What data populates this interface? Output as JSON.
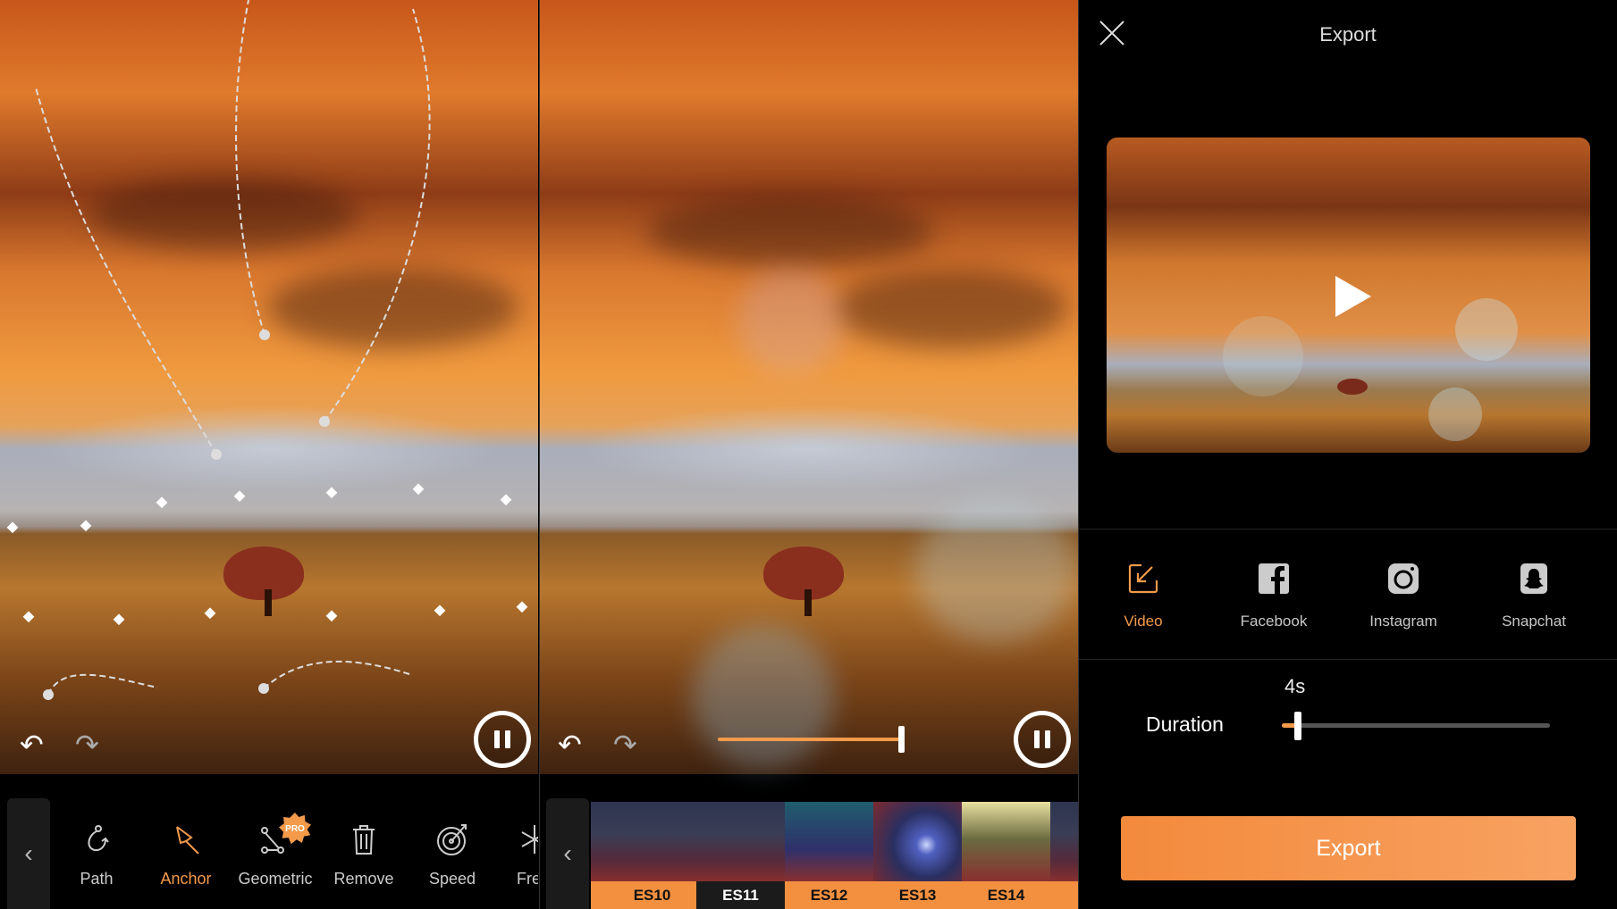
{
  "left_panel": {
    "tools": [
      {
        "label": "Path",
        "icon": "path-icon",
        "active": false
      },
      {
        "label": "Anchor",
        "icon": "anchor-pin-icon",
        "active": true
      },
      {
        "label": "Geometric",
        "icon": "geometric-icon",
        "active": false,
        "badge": "PRO"
      },
      {
        "label": "Remove",
        "icon": "trash-icon",
        "active": false
      },
      {
        "label": "Speed",
        "icon": "speed-icon",
        "active": false
      },
      {
        "label": "Fre",
        "icon": "freeze-icon",
        "active": false
      }
    ]
  },
  "middle_panel": {
    "intensity_fraction": 1.0,
    "effects": [
      {
        "label": "ES10",
        "selected": false
      },
      {
        "label": "ES11",
        "selected": true
      },
      {
        "label": "ES12",
        "selected": false
      },
      {
        "label": "ES13",
        "selected": false
      },
      {
        "label": "ES14",
        "selected": false
      }
    ]
  },
  "export_panel": {
    "title": "Export",
    "destinations": [
      {
        "label": "Video",
        "icon": "save-video-icon",
        "active": true
      },
      {
        "label": "Facebook",
        "icon": "facebook-icon",
        "active": false
      },
      {
        "label": "Instagram",
        "icon": "instagram-icon",
        "active": false
      },
      {
        "label": "Snapchat",
        "icon": "snapchat-icon",
        "active": false
      }
    ],
    "duration_label": "Duration",
    "duration_value": "4s",
    "duration_fraction": 0.06,
    "export_button": "Export"
  },
  "colors": {
    "accent": "#f39a4b",
    "background": "#000000"
  }
}
